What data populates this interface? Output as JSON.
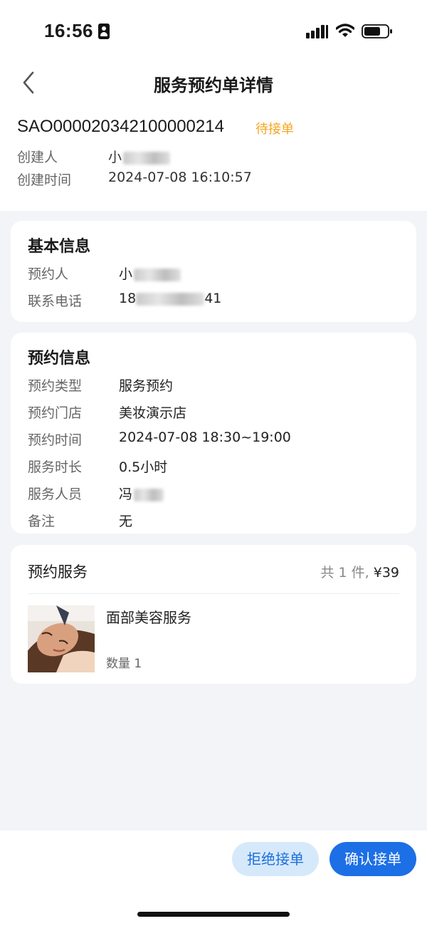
{
  "status_bar": {
    "time": "16:56"
  },
  "nav": {
    "title": "服务预约单详情"
  },
  "order": {
    "number": "SAO000020342100000214",
    "status": "待接单",
    "creator_label": "创建人",
    "creator_value": "小",
    "created_time_label": "创建时间",
    "created_time_value": "2024-07-08 16:10:57"
  },
  "basic_info": {
    "title": "基本信息",
    "booker_label": "预约人",
    "booker_value": "小",
    "phone_label": "联系电话",
    "phone_prefix": "18",
    "phone_suffix": "41"
  },
  "booking_info": {
    "title": "预约信息",
    "rows": [
      {
        "label": "预约类型",
        "value": "服务预约"
      },
      {
        "label": "预约门店",
        "value": "美妆演示店"
      },
      {
        "label": "预约时间",
        "value": "2024-07-08 18:30~19:00"
      },
      {
        "label": "服务时长",
        "value": "0.5小时"
      },
      {
        "label": "服务人员",
        "value": "冯"
      },
      {
        "label": "备注",
        "value": "无"
      }
    ]
  },
  "services": {
    "title": "预约服务",
    "summary_count": "共 1 件, ",
    "summary_price": "¥39",
    "items": [
      {
        "name": "面部美容服务",
        "quantity": "数量 1"
      }
    ]
  },
  "actions": {
    "reject": "拒绝接单",
    "accept": "确认接单"
  },
  "colors": {
    "accent": "#1d6fe6",
    "pending": "#f5a623",
    "background": "#f3f4f7"
  }
}
